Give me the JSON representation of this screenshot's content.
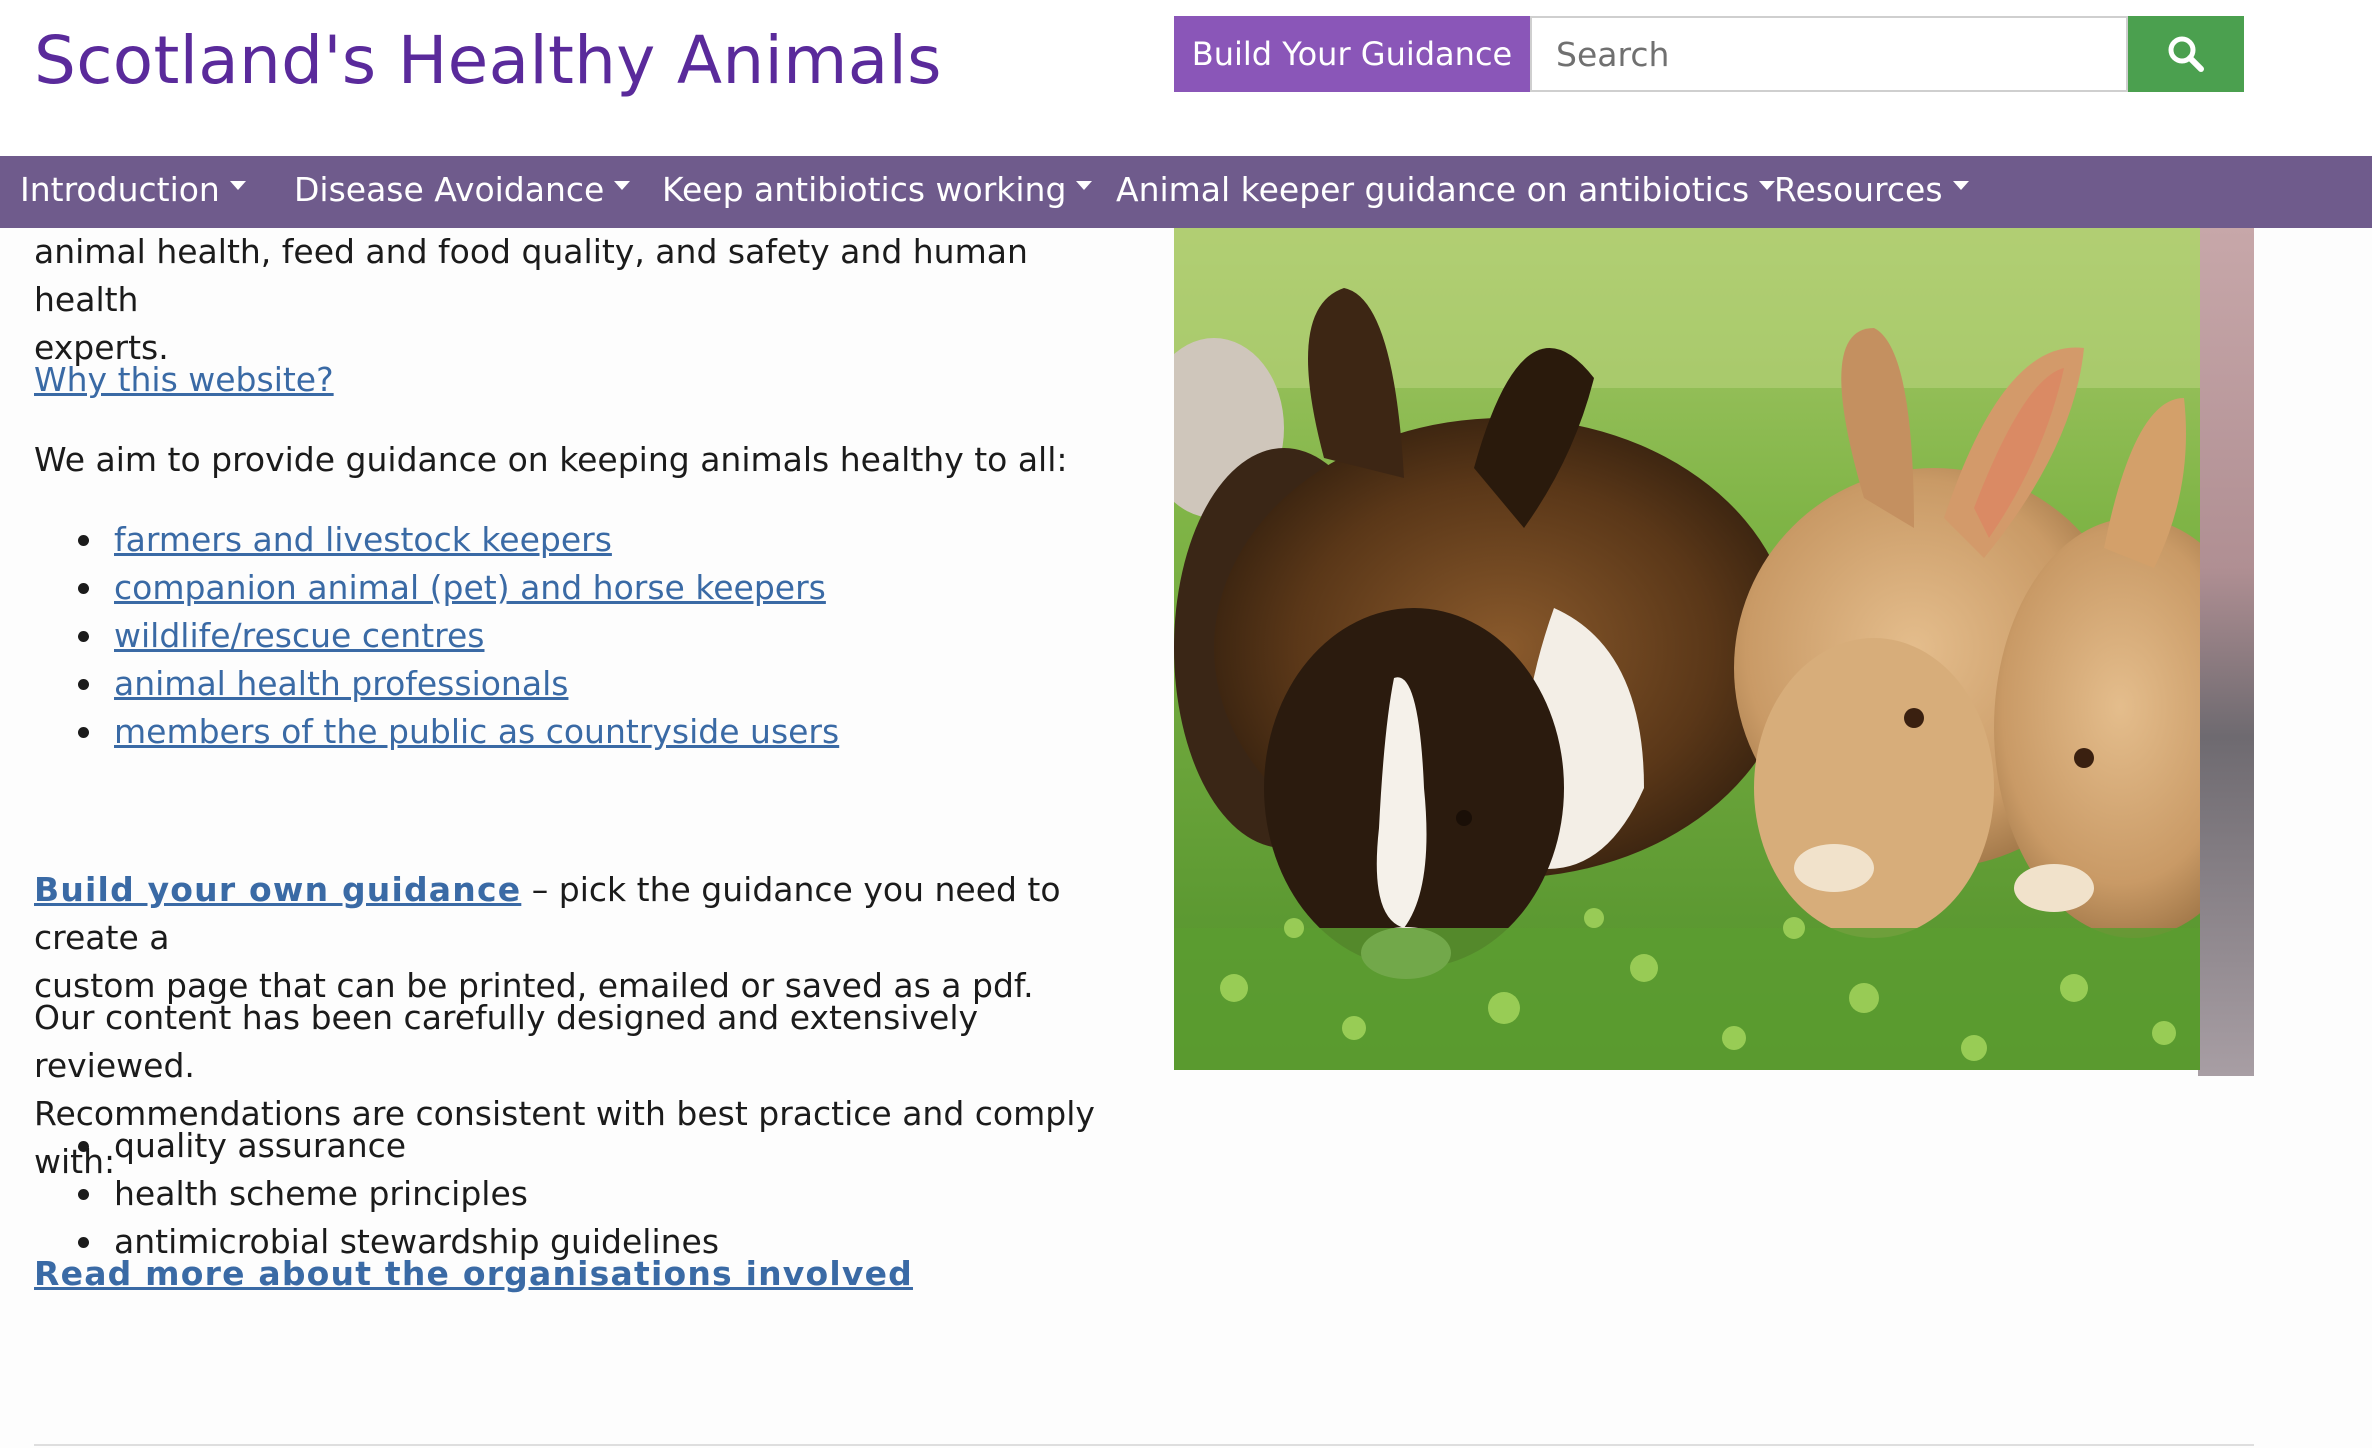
{
  "header": {
    "site_title": "Scotland's Healthy Animals",
    "build_button": "Build Your Guidance",
    "search_placeholder": "Search",
    "search_icon": "search-icon"
  },
  "nav": {
    "items": [
      {
        "label": "Introduction"
      },
      {
        "label": "Disease Avoidance"
      },
      {
        "label": "Keep antibiotics working"
      },
      {
        "label": "Animal keeper guidance on antibiotics"
      },
      {
        "label": "Resources"
      }
    ]
  },
  "content": {
    "intro_line_1": "animal health, feed and food quality, and safety and human health",
    "intro_line_2": "experts.",
    "why_link": "Why this website?",
    "aim_text": "We aim to provide guidance on keeping animals healthy to all:",
    "audiences": [
      "farmers and livestock keepers",
      "companion animal (pet) and horse keepers",
      "wildlife/rescue centres",
      "animal health professionals",
      "members of the public as countryside users"
    ],
    "build_link": "Build your own guidance",
    "build_text_1": " – pick the guidance you need to create a",
    "build_text_2": "custom page that can be printed, emailed or saved as a pdf.",
    "review_line_1": "Our content has been carefully designed and extensively reviewed.",
    "review_line_2": "Recommendations are consistent with best practice and comply with:",
    "standards": [
      "quality assurance",
      "health scheme principles",
      "antimicrobial stewardship guidelines"
    ],
    "read_more_link": "Read more about the organisations involved"
  },
  "colors": {
    "title": "#5a2a9b",
    "build_button": "#8a56b8",
    "search_button": "#4ba04f",
    "nav_bar": "#6f5b8c",
    "link": "#3a6aa5"
  }
}
